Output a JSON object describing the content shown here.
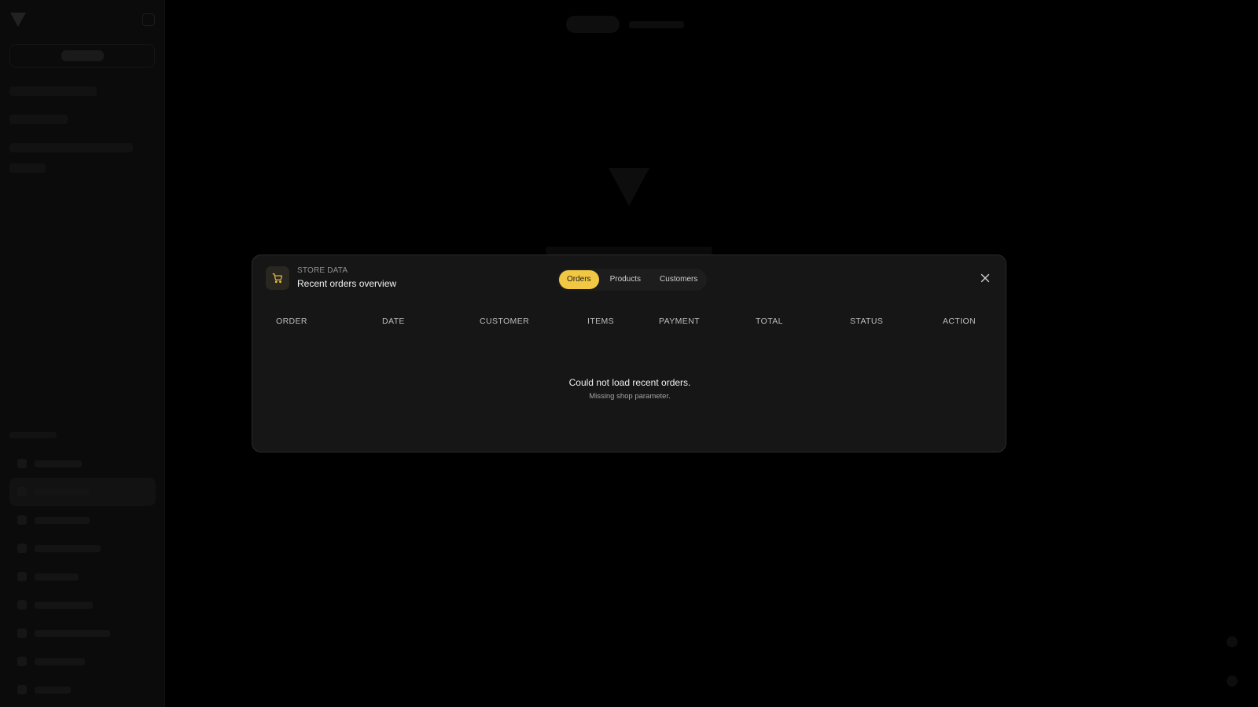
{
  "modal": {
    "eyebrow": "STORE DATA",
    "title": "Recent orders overview",
    "icon": "shopping-cart-icon",
    "tabs": [
      {
        "label": "Orders",
        "active": true
      },
      {
        "label": "Products",
        "active": false
      },
      {
        "label": "Customers",
        "active": false
      }
    ],
    "close_icon": "close-icon",
    "table": {
      "columns": [
        "ORDER",
        "DATE",
        "CUSTOMER",
        "ITEMS",
        "PAYMENT",
        "TOTAL",
        "STATUS",
        "ACTION"
      ]
    },
    "empty_state": {
      "title": "Could not load recent orders.",
      "subtitle": "Missing shop parameter."
    }
  },
  "colors": {
    "accent": "#f2c744",
    "modal_bg": "#161616",
    "page_bg": "#000000"
  }
}
